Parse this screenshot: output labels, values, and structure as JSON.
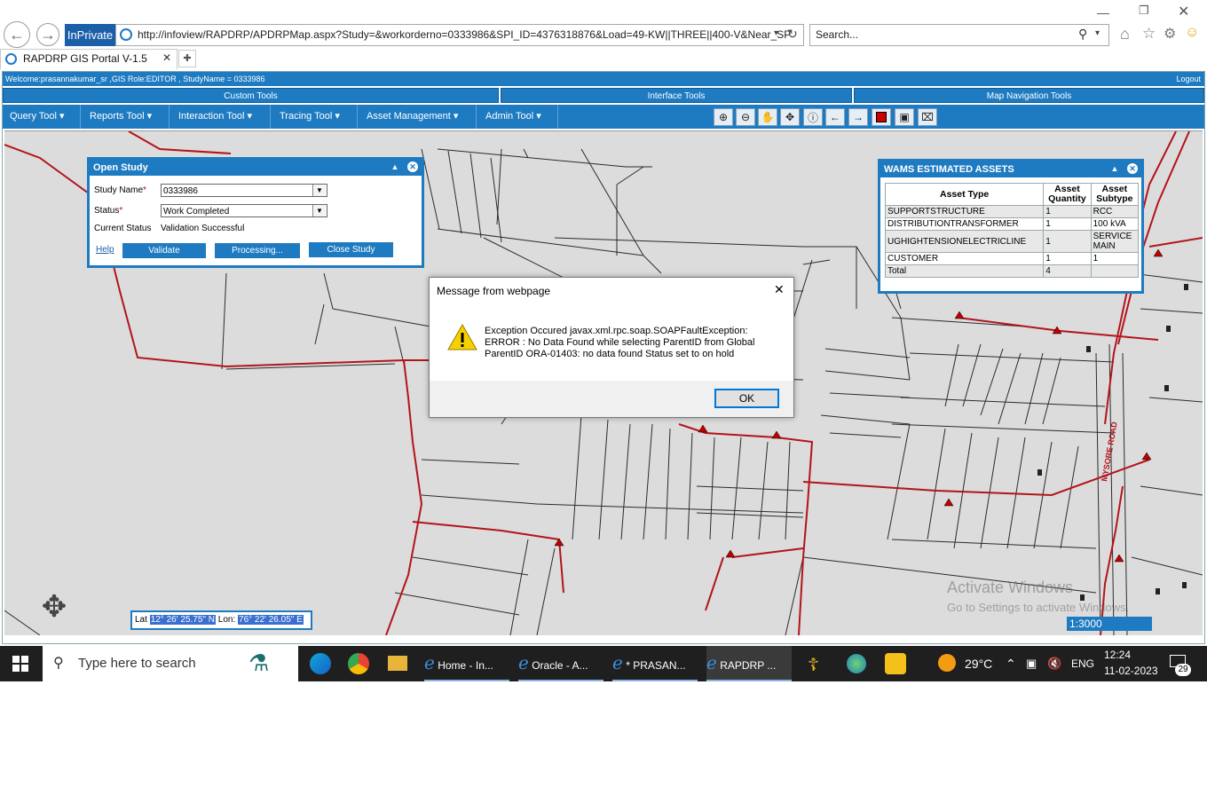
{
  "browser": {
    "inprivate_label": "InPrivate",
    "url": "http://infoview/RAPDRP/APDRPMap.aspx?Study=&workorderno=0333986&SPI_ID=4376318876&Load=49-KW||THREE||400-V&Near_SP",
    "search_placeholder": "Search...",
    "tab_title": "RAPDRP GIS Portal V-1.5"
  },
  "app": {
    "welcome": "Welcome:prasannakumar_sr ,GIS Role:EDITOR , StudyName = 0333986",
    "logout": "Logout",
    "tool_headers": [
      "Custom Tools",
      "Interface Tools",
      "Map Navigation Tools"
    ],
    "menus": [
      "Query Tool",
      "Reports Tool",
      "Interaction Tool",
      "Tracing Tool",
      "Asset Management",
      "Admin Tool"
    ]
  },
  "open_study": {
    "title": "Open Study",
    "study_name_label": "Study Name",
    "study_name_value": "0333986",
    "status_label": "Status",
    "status_value": "Work Completed",
    "current_status_label": "Current Status",
    "current_status_value": "Validation Successful",
    "help": "Help",
    "validate": "Validate",
    "processing": "Processing...",
    "close_study": "Close Study"
  },
  "wams": {
    "title": "WAMS ESTIMATED ASSETS",
    "headers": [
      "Asset Type",
      "Asset Quantity",
      "Asset Subtype"
    ],
    "rows": [
      [
        "SUPPORTSTRUCTURE",
        "1",
        "RCC"
      ],
      [
        "DISTRIBUTIONTRANSFORMER",
        "1",
        "100 kVA"
      ],
      [
        "UGHIGHTENSIONELECTRICLINE",
        "1",
        "SERVICE MAIN"
      ],
      [
        "CUSTOMER",
        "1",
        "1"
      ],
      [
        "Total",
        "4",
        ""
      ]
    ]
  },
  "dialog": {
    "title": "Message from webpage",
    "line1": "Exception Occured javax.xml.rpc.soap.SOAPFaultException:",
    "line2": "ERROR : No Data Found while selecting ParentID from Global",
    "line3": "ParentID ORA-01403: no data found  Status set to on hold",
    "ok": "OK"
  },
  "map": {
    "lat_label": "Lat",
    "lat_value": "12° 26' 25.75\" N",
    "lon_label": "Lon:",
    "lon_value": "76° 22' 26.05\" E",
    "scale": "1:3000",
    "road_label": "MYSORE ROAD",
    "activate_line1": "Activate Windows",
    "activate_line2": "Go to Settings to activate Windows."
  },
  "taskbar": {
    "search_placeholder": "Type here to search",
    "apps": [
      "Home - In...",
      "Oracle - A...",
      "* PRASAN...",
      "RAPDRP ..."
    ],
    "temperature": "29°C",
    "language": "ENG",
    "time": "12:24",
    "date": "11-02-2023",
    "notifications": "29"
  },
  "colors": {
    "app_blue": "#1e7bc2",
    "map_bg": "#dcdcdc",
    "line_red": "#b3141b",
    "taskbar": "#1f1f1f"
  }
}
